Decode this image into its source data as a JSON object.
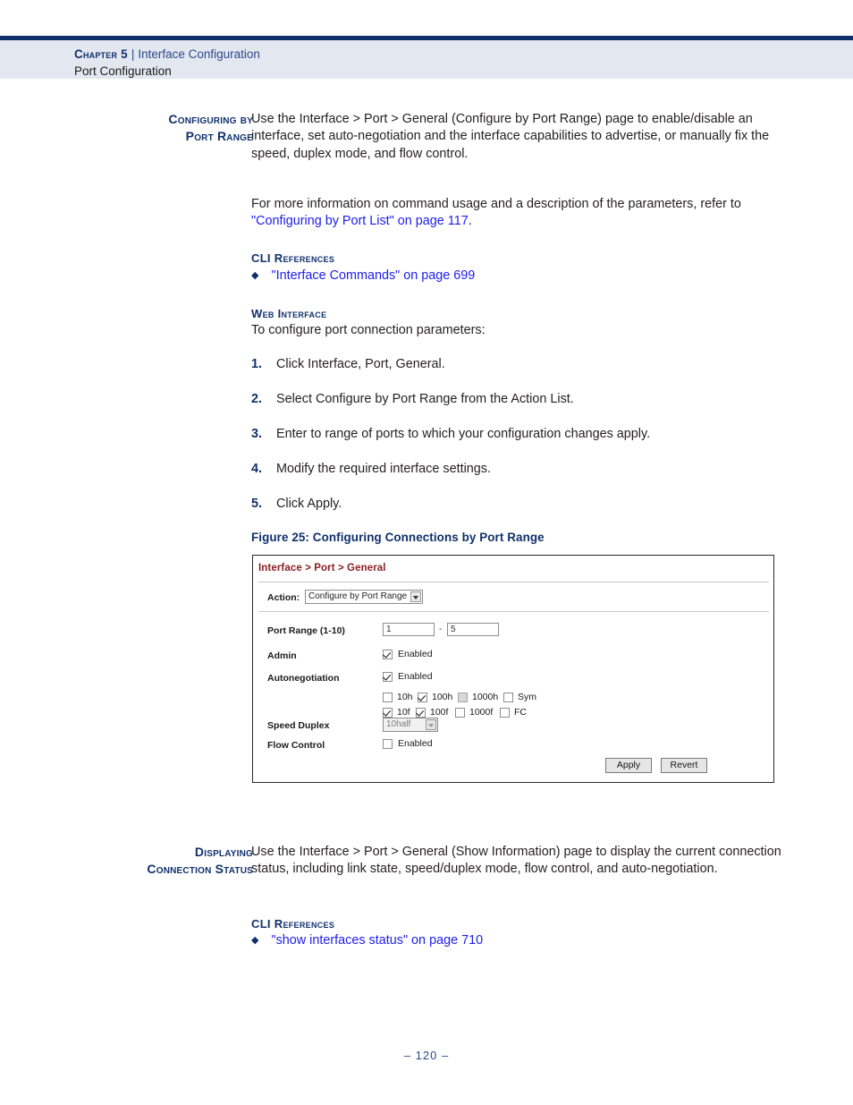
{
  "header": {
    "chapter_label": "Chapter 5",
    "separator": "|",
    "chapter_title": "Interface Configuration",
    "section_title": "Port Configuration"
  },
  "section1": {
    "margin_heading_line1": "Configuring by",
    "margin_heading_line2": "Port Range",
    "paragraph1": "Use the Interface > Port > General (Configure by Port Range) page to enable/disable an interface, set auto-negotiation and the interface capabilities to advertise, or manually fix the speed, duplex mode, and flow control.",
    "paragraph2_pre": "For more information on command usage and a description of the parameters, refer to ",
    "paragraph2_link": "\"Configuring by Port List\" on page 117",
    "paragraph2_post": ".",
    "cli_references_heading": "CLI References",
    "cli_reference_link": "\"Interface Commands\" on page 699",
    "web_interface_heading": "Web Interface",
    "web_interface_intro": "To configure port connection parameters:",
    "steps": [
      {
        "num": "1.",
        "text": "Click Interface, Port, General."
      },
      {
        "num": "2.",
        "text": "Select Configure by Port Range from the Action List."
      },
      {
        "num": "3.",
        "text": "Enter to range of ports to which your configuration changes apply."
      },
      {
        "num": "4.",
        "text": "Modify the required interface settings."
      },
      {
        "num": "5.",
        "text": "Click Apply."
      }
    ],
    "figure_caption": "Figure 25:  Configuring Connections by Port Range"
  },
  "figure": {
    "breadcrumb": "Interface > Port > General",
    "action_label": "Action:",
    "action_value": "Configure by Port Range",
    "port_range_label": "Port Range (1-10)",
    "port_range_start": "1",
    "port_range_dash": "-",
    "port_range_end": "5",
    "admin_label": "Admin",
    "admin_checkbox_text": "Enabled",
    "autoneg_label": "Autonegotiation",
    "autoneg_checkbox_text": "Enabled",
    "caps_row1": [
      {
        "label": "10h",
        "checked": false,
        "disabled": false
      },
      {
        "label": "100h",
        "checked": true,
        "disabled": false
      },
      {
        "label": "1000h",
        "checked": false,
        "disabled": true
      },
      {
        "label": "Sym",
        "checked": false,
        "disabled": false
      }
    ],
    "caps_row2": [
      {
        "label": "10f",
        "checked": true,
        "disabled": false
      },
      {
        "label": "100f",
        "checked": true,
        "disabled": false
      },
      {
        "label": "1000f",
        "checked": false,
        "disabled": false
      },
      {
        "label": "FC",
        "checked": false,
        "disabled": false
      }
    ],
    "speed_duplex_label": "Speed Duplex",
    "speed_duplex_value": "10half",
    "flow_control_label": "Flow Control",
    "flow_control_checkbox_text": "Enabled",
    "apply_button": "Apply",
    "revert_button": "Revert"
  },
  "section2": {
    "margin_heading_line1": "Displaying",
    "margin_heading_line2": "Connection Status",
    "paragraph1": "Use the Interface > Port > General (Show Information) page to display the current connection status, including link state, speed/duplex mode, flow control, and auto-negotiation.",
    "cli_references_heading": "CLI References",
    "cli_reference_link": "\"show interfaces status\" on page 710"
  },
  "footer": {
    "page_number": "–  120  –"
  },
  "colors": {
    "navy": "#10306b",
    "link_blue": "#1d1df0",
    "header_band": "#e3e7f0",
    "breadcrumb_red": "#8a2024"
  }
}
